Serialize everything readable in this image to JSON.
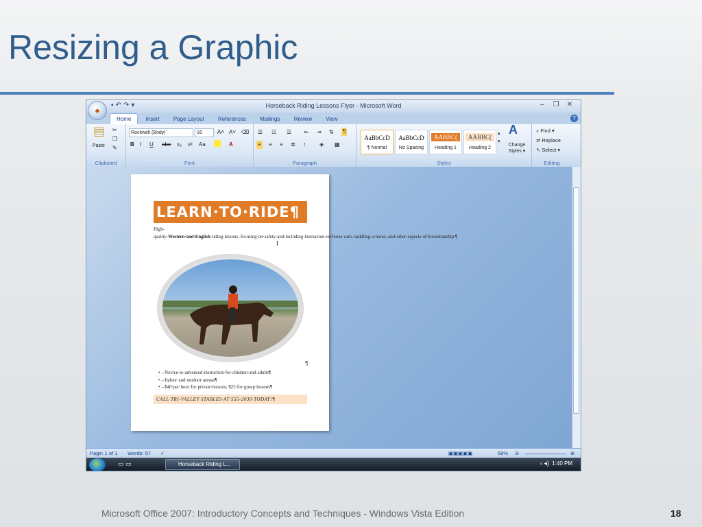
{
  "slide": {
    "title": "Resizing a Graphic",
    "footer": "Microsoft Office 2007: Introductory Concepts and Techniques - Windows Vista Edition",
    "page_number": "18"
  },
  "window": {
    "title": "Horseback Riding Lessons Flyer - Microsoft Word",
    "minimize": "–",
    "restore": "❐",
    "close": "✕",
    "help": "?"
  },
  "tabs": [
    "Home",
    "Insert",
    "Page Layout",
    "References",
    "Mailings",
    "Review",
    "View"
  ],
  "ribbon": {
    "clipboard": {
      "label": "Clipboard",
      "paste": "Paste"
    },
    "font": {
      "label": "Font",
      "name": "Rockwell (Body)",
      "size": "16",
      "bold": "B",
      "italic": "I",
      "underline": "U",
      "strike": "abe",
      "sub": "x₂",
      "sup": "x²",
      "case": "Aa",
      "grow": "A˄",
      "shrink": "A˅"
    },
    "paragraph": {
      "label": "Paragraph"
    },
    "styles": {
      "label": "Styles",
      "items": [
        {
          "sample": "AaBbCcD",
          "name": "¶ Normal"
        },
        {
          "sample": "AaBbCcD",
          "name": "No Spacing"
        },
        {
          "sample": "AABBC(",
          "name": "Heading 1"
        },
        {
          "sample": "AABBC(",
          "name": "Heading 2"
        }
      ],
      "change": "Change Styles ▾"
    },
    "editing": {
      "label": "Editing",
      "find": "Find ▾",
      "replace": "Replace",
      "select": "Select ▾"
    }
  },
  "document": {
    "banner": "LEARN·TO·RIDE¶",
    "intro_bold": "Western·and·English",
    "intro_pre": "High-quality·",
    "intro_post": "·riding·lessons,·focusing·on·safety·and·including·instruction·on·horse·care,·saddling·a·horse,·and·other·aspects·of·horsemanship.¶",
    "pilcrow": "¶",
    "bullets": [
      "•→Novice·to·advanced·instruction·for·children·and·adults¶",
      "•→Indoor·and·outdoor·arenas¶",
      "•→$40·per·hour·for·private·lessons;·$25·for·group·lessons¶"
    ],
    "call": "CALL·TRI-VALLEY·STABLES·AT·555-2030·TODAY!¶"
  },
  "status": {
    "page": "Page: 1 of 1",
    "words": "Words: 57",
    "zoom": "58%"
  },
  "taskbar": {
    "button": "Horseback Riding L...",
    "clock": "1:40 PM"
  }
}
